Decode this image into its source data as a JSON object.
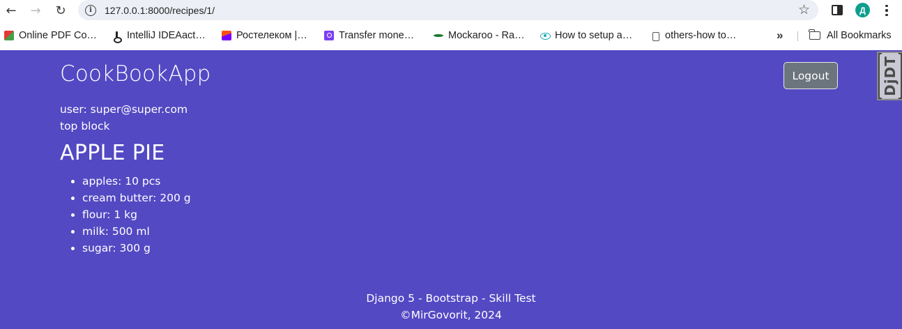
{
  "browser": {
    "url": "127.0.0.1:8000/recipes/1/",
    "profile_initial": "Д",
    "bookmarks": [
      {
        "label": "Online PDF Co…",
        "icon": "pdf-favicon"
      },
      {
        "label": "IntelliJ IDEAact…",
        "icon": "intellij-favicon"
      },
      {
        "label": "Ростелеком |…",
        "icon": "rostelecom-favicon"
      },
      {
        "label": "Transfer mone…",
        "icon": "transfer-favicon"
      },
      {
        "label": "Mockaroo - Ra…",
        "icon": "mockaroo-favicon"
      },
      {
        "label": "How to setup a…",
        "icon": "eye-favicon"
      },
      {
        "label": "others-how to…",
        "icon": "others-favicon"
      }
    ],
    "all_bookmarks_label": "All Bookmarks"
  },
  "header": {
    "brand": "CookBookApp",
    "logout_label": "Logout",
    "debug_toolbar_label": "DjDT"
  },
  "user_line": "user: super@super.com",
  "top_block": "top block",
  "recipe": {
    "title": "APPLE PIE",
    "ingredients": [
      "apples: 10 pcs",
      "cream butter: 200 g",
      "flour: 1 kg",
      "milk: 500 ml",
      "sugar: 300 g"
    ]
  },
  "footer": {
    "line1": "Django 5 - Bootstrap - Skill Test",
    "line2": "©MirGovorit, 2024"
  },
  "colors": {
    "page_background": "#5349c3",
    "logout_button": "#6c757d"
  }
}
